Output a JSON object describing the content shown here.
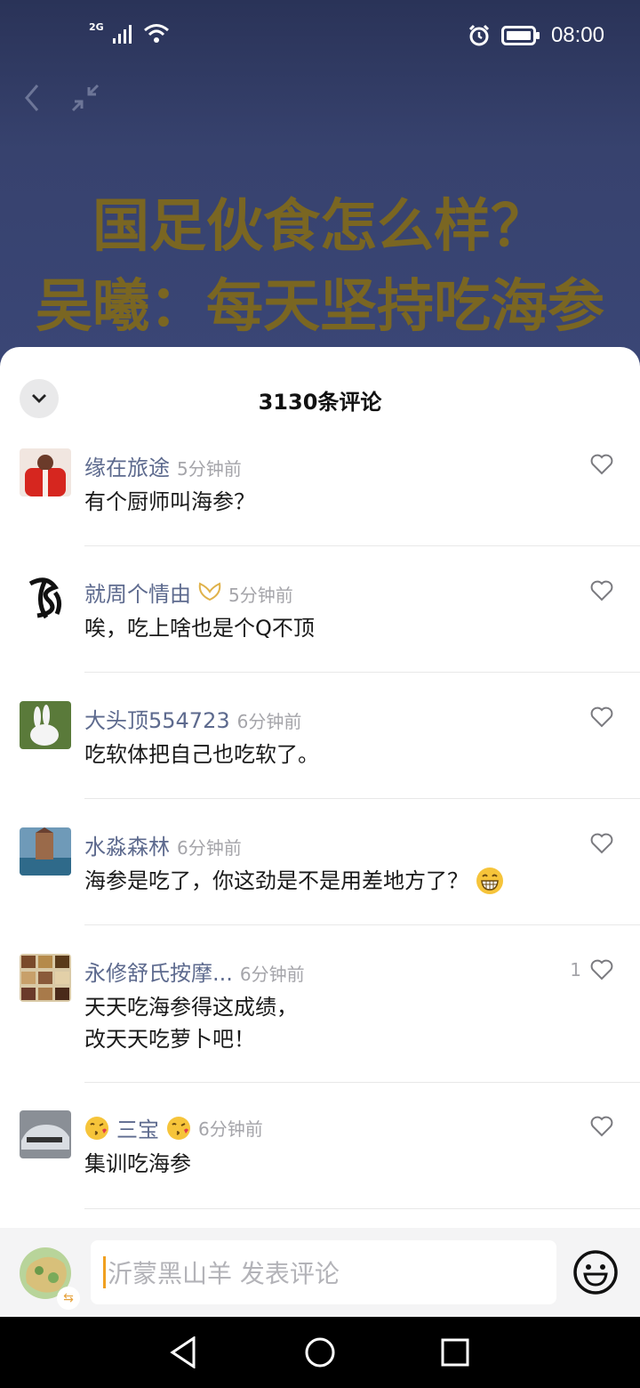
{
  "status_bar": {
    "network": "2G",
    "time": "08:00"
  },
  "headline": {
    "line1": "国足伙食怎么样？",
    "line2": "吴曦：每天坚持吃海参"
  },
  "comments_panel": {
    "title": "3130条评论"
  },
  "comments": [
    {
      "name": "缘在旅途",
      "time": "5分钟前",
      "text": "有个厨师叫海参？",
      "likes": ""
    },
    {
      "name": "就周个情由",
      "time": "5分钟前",
      "text": "唉，吃上啥也是个Q不顶",
      "likes": ""
    },
    {
      "name": "大头顶554723",
      "time": "6分钟前",
      "text": "吃软体把自己也吃软了。",
      "likes": ""
    },
    {
      "name": "水淼森林",
      "time": "6分钟前",
      "text": "海参是吃了，你这劲是不是用差地方了？",
      "likes": ""
    },
    {
      "name": "永修舒氏按摩...",
      "time": "6分钟前",
      "text_line1": "天天吃海参得这成绩，",
      "text_line2": "改天天吃萝卜吧！",
      "likes": "1"
    },
    {
      "name": "三宝",
      "time": "6分钟前",
      "text": "集训吃海参",
      "likes": ""
    }
  ],
  "input": {
    "placeholder": "沂蒙黑山羊 发表评论"
  },
  "colors": {
    "headline": "#7a6622",
    "username": "#5d6a8e",
    "caret": "#f0a020"
  }
}
